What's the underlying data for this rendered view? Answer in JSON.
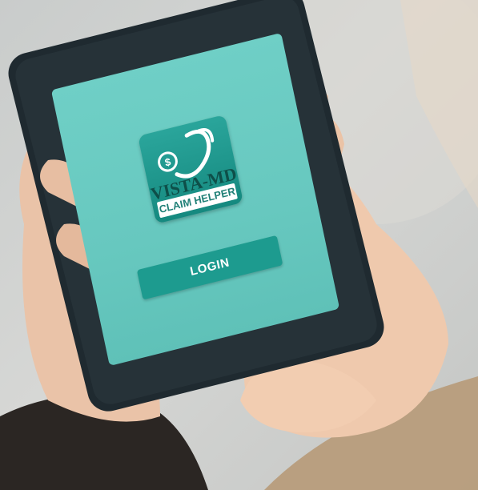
{
  "app": {
    "logo": {
      "brand_text": "VISTA-MD",
      "tagline": "CLAIM HELPER",
      "icon": "stethoscope-dollar-icon"
    },
    "login_label": "LOGIN"
  },
  "colors": {
    "screen_teal": "#6fcfc6",
    "logo_teal": "#15897f",
    "button_teal": "#1d9b8f",
    "phone_frame": "#1f2a30"
  }
}
